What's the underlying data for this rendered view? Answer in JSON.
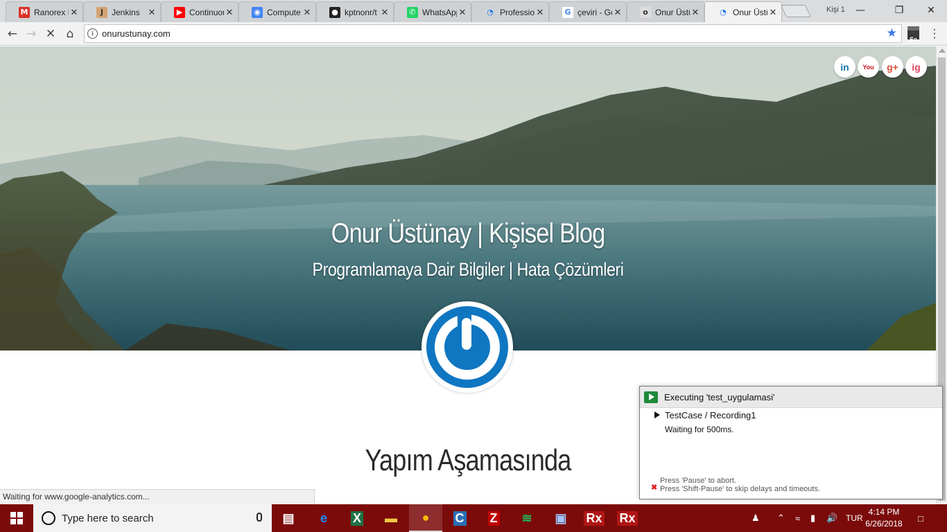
{
  "browser": {
    "tabs": [
      {
        "title": "Ranorex B",
        "icon": "gmail-icon",
        "active": false
      },
      {
        "title": "Jenkins",
        "icon": "jenkins-icon",
        "active": false
      },
      {
        "title": "Continuou",
        "icon": "youtube-icon",
        "active": false
      },
      {
        "title": "Compute",
        "icon": "chip-icon",
        "active": false
      },
      {
        "title": "kptnonr/t",
        "icon": "github-icon",
        "active": false
      },
      {
        "title": "WhatsApp",
        "icon": "whatsapp-icon",
        "active": false
      },
      {
        "title": "Profession",
        "icon": "loading-icon",
        "active": false
      },
      {
        "title": "çeviri - Go",
        "icon": "google-icon",
        "active": false
      },
      {
        "title": "Onur Üstü",
        "icon": "site-icon",
        "active": false
      },
      {
        "title": "Onur Üstü",
        "icon": "loading-icon",
        "active": true
      }
    ],
    "profile_label": "Kişi 1",
    "url": "onurustunay.com",
    "status_text": "Waiting for www.google-analytics.com...",
    "extension_label": "Se"
  },
  "page": {
    "hero_title": "Onur Üstünay | Kişisel Blog",
    "hero_subtitle": "Programlamaya Dair Bilgiler | Hata Çözümleri",
    "social": [
      {
        "label": "in",
        "name": "linkedin-icon",
        "color": "#0e76a8"
      },
      {
        "label": "You",
        "name": "youtube-icon",
        "color": "#cc181e"
      },
      {
        "label": "g+",
        "name": "google-plus-icon",
        "color": "#dd4b39"
      },
      {
        "label": "ig",
        "name": "instagram-icon",
        "color": "#e4405f"
      }
    ],
    "heading": "Yapım Aşamasında",
    "logo_color": "#0f76c1"
  },
  "ranorex": {
    "title": "Executing 'test_uygulamasi'",
    "testcase": "TestCase / Recording1",
    "status": "Waiting for 500ms.",
    "hint1": "Press 'Pause' to abort.",
    "hint2": "Press 'Shift-Pause' to skip delays and timeouts."
  },
  "taskbar": {
    "search_placeholder": "Type here to search",
    "apps": [
      "task-view-icon",
      "edge-icon",
      "excel-icon",
      "file-explorer-icon",
      "chrome-icon",
      "dotnet-icon",
      "filezilla-icon",
      "spotify-icon",
      "remote-desktop-icon",
      "ranorex-icon",
      "ranorex-icon"
    ],
    "language": "TUR",
    "time": "4:14 PM",
    "date": "6/26/2018",
    "color": "#7b0b0b"
  }
}
